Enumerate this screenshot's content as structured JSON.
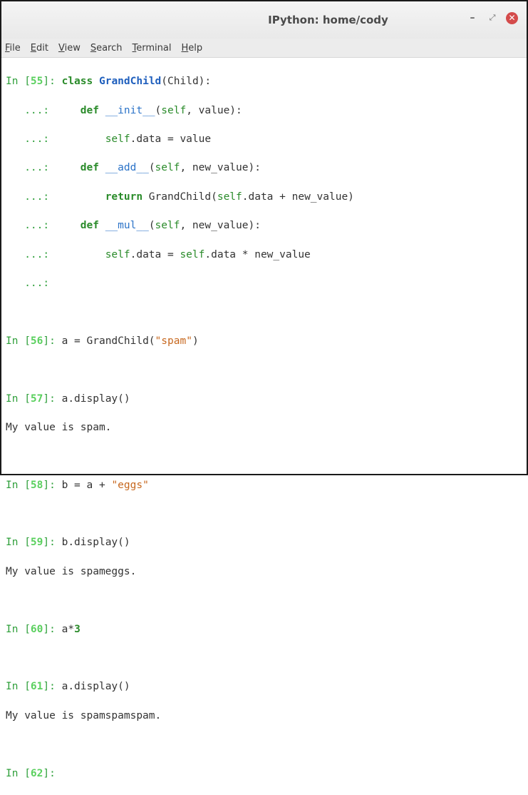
{
  "window": {
    "title": "IPython: home/cody",
    "minimize": "–",
    "maximize": "⤢",
    "close": "✕"
  },
  "menu": [
    {
      "label": "File",
      "u": "F",
      "rest": "ile"
    },
    {
      "label": "Edit",
      "u": "E",
      "rest": "dit"
    },
    {
      "label": "View",
      "u": "V",
      "rest": "iew"
    },
    {
      "label": "Search",
      "u": "S",
      "rest": "earch"
    },
    {
      "label": "Terminal",
      "u": "T",
      "rest": "erminal"
    },
    {
      "label": "Help",
      "u": "H",
      "rest": "elp"
    }
  ],
  "session": {
    "in55": {
      "prompt": "In [",
      "num": "55",
      "close": "]: "
    },
    "l1": {
      "kw": "class",
      "cls": "GrandChild",
      "rest": "(Child):"
    },
    "cont": "   ...:     ",
    "l2": {
      "kw": "def",
      "fn": "__init__",
      "p1": "(",
      "self": "self",
      "p2": ", value):"
    },
    "l3": {
      "self": "self",
      "rest": ".data = value"
    },
    "l4": {
      "kw": "def",
      "fn": "__add__",
      "p1": "(",
      "self": "self",
      "p2": ", new_value):"
    },
    "l5": {
      "kw": "return",
      "a": " GrandChild(",
      "self": "self",
      "b": ".data + new_value)"
    },
    "l6": {
      "kw": "def",
      "fn": "__mul__",
      "p1": "(",
      "self": "self",
      "p2": ", new_value):"
    },
    "l7": {
      "self": "self",
      "a": ".data = ",
      "self2": "self",
      "b": ".data * new_value"
    },
    "in56": {
      "num": "56",
      "a": "a = GrandChild(",
      "str": "\"spam\"",
      "b": ")"
    },
    "in57": {
      "num": "57",
      "code": "a.display()",
      "out": "My value is spam."
    },
    "in58": {
      "num": "58",
      "a": "b = a + ",
      "str": "\"eggs\""
    },
    "in59": {
      "num": "59",
      "code": "b.display()",
      "out": "My value is spameggs."
    },
    "in60": {
      "num": "60",
      "a": "a*",
      "n": "3"
    },
    "in61": {
      "num": "61",
      "code": "a.display()",
      "out": "My value is spamspamspam."
    },
    "in62": {
      "num": "62"
    }
  }
}
